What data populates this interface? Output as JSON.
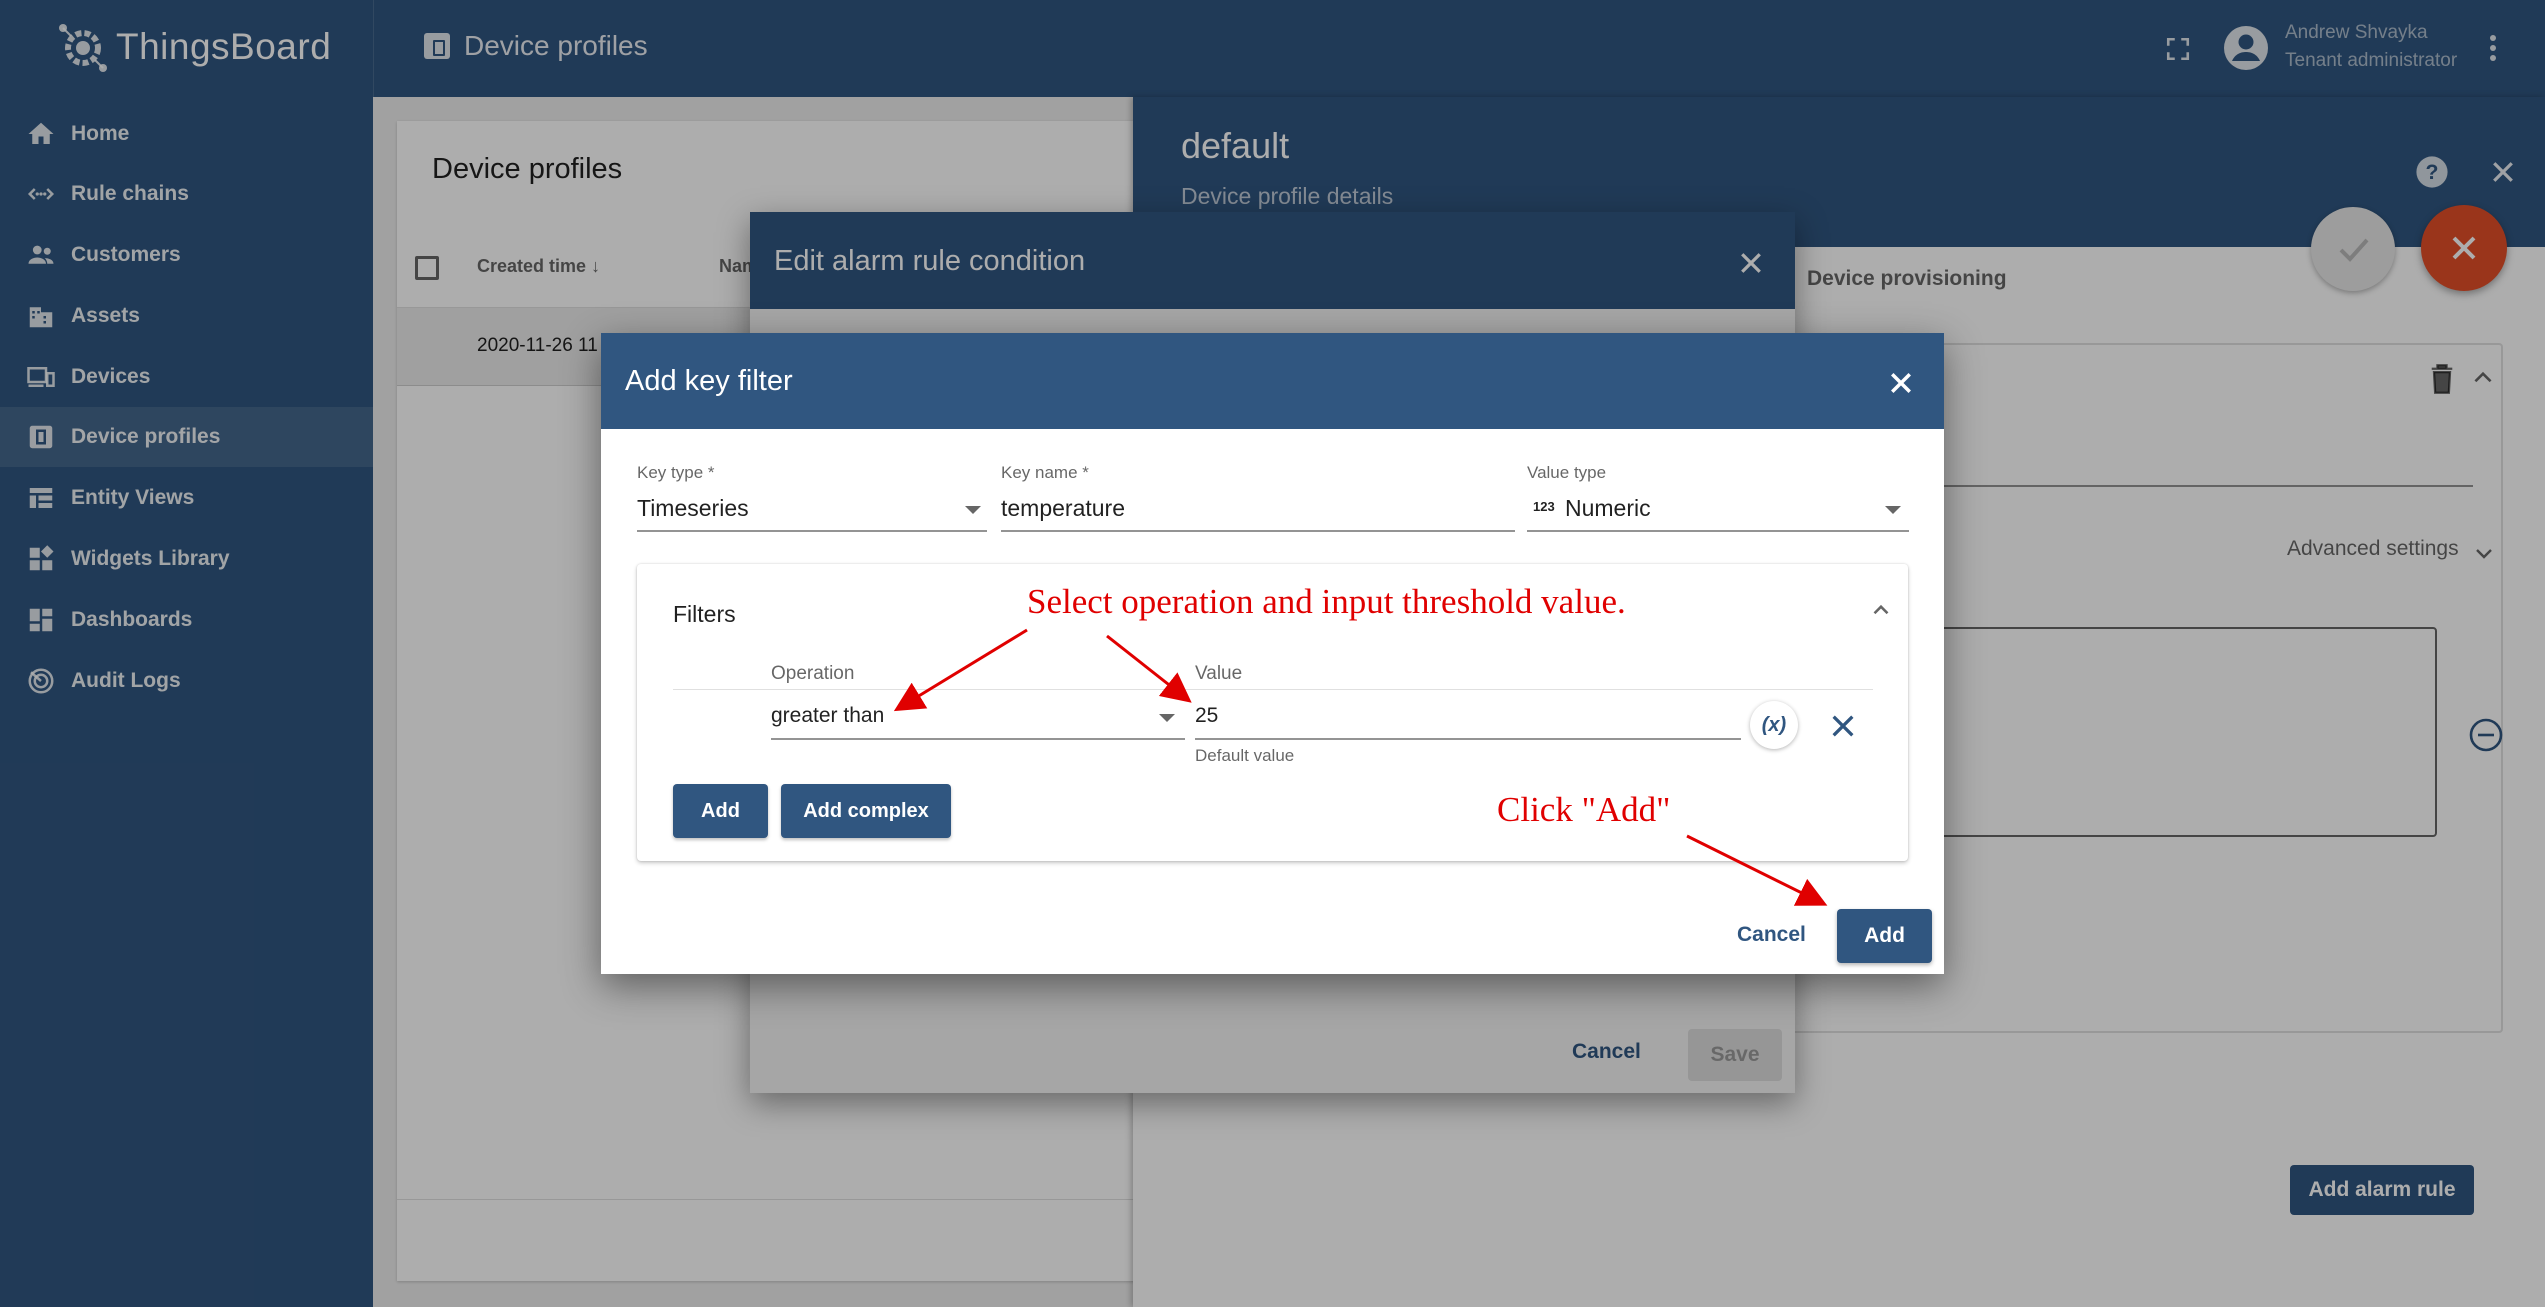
{
  "app": {
    "logo_text": "ThingsBoard",
    "page_title": "Device profiles",
    "user_name": "Andrew Shvayka",
    "user_role": "Tenant administrator"
  },
  "sidebar": {
    "items": [
      {
        "label": "Home",
        "icon": "home-icon"
      },
      {
        "label": "Rule chains",
        "icon": "rule-chains-icon"
      },
      {
        "label": "Customers",
        "icon": "customers-icon"
      },
      {
        "label": "Assets",
        "icon": "assets-icon"
      },
      {
        "label": "Devices",
        "icon": "devices-icon"
      },
      {
        "label": "Device profiles",
        "icon": "device-profiles-icon",
        "active": true
      },
      {
        "label": "Entity Views",
        "icon": "entity-views-icon"
      },
      {
        "label": "Widgets Library",
        "icon": "widgets-library-icon"
      },
      {
        "label": "Dashboards",
        "icon": "dashboards-icon"
      },
      {
        "label": "Audit Logs",
        "icon": "audit-logs-icon"
      }
    ]
  },
  "list": {
    "title": "Device profiles",
    "col_created": "Created time",
    "col_name": "Nam",
    "row_created": "2020-11-26 11"
  },
  "details": {
    "title": "default",
    "subtitle": "Device profile details",
    "tab_provisioning": "Device provisioning",
    "advanced_settings": "Advanced settings",
    "add_alarm_rule": "Add alarm rule"
  },
  "alarm_dialog": {
    "title": "Edit alarm rule condition",
    "cancel": "Cancel",
    "save": "Save"
  },
  "key_filter_dialog": {
    "title": "Add key filter",
    "key_type_label": "Key type *",
    "key_type_value": "Timeseries",
    "key_name_label": "Key name *",
    "key_name_value": "temperature",
    "value_type_label": "Value type",
    "value_type_prefix": "123",
    "value_type_value": "Numeric",
    "filters_title": "Filters",
    "operation_header": "Operation",
    "value_header": "Value",
    "operation_value": "greater than",
    "value_value": "25",
    "value_hint": "Default value",
    "dynamic_value_button": "(x)",
    "add_filter": "Add",
    "add_complex": "Add complex",
    "cancel": "Cancel",
    "add": "Add"
  },
  "annotations": {
    "select_operation": "Select operation and input threshold value.",
    "click_add": "Click \"Add\""
  },
  "colors": {
    "primary": "#305680",
    "fab_cancel": "#e44f29",
    "annotation": "#e00000"
  }
}
